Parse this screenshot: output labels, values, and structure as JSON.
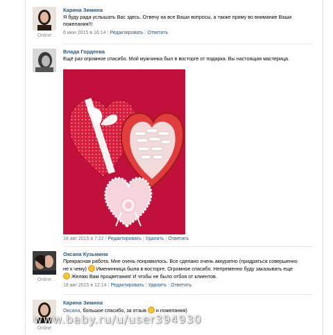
{
  "posts": [
    {
      "author": "Карина Зимина",
      "status": "Online",
      "text": "Я буду рада услышать Вас здесь. Отвечу на все Ваши вопросы, а также приму во внимание Ваши пожелания!!!",
      "date": "6 июн 2015 в 16:14",
      "actions": [
        "Редактировать",
        "Ответить"
      ]
    },
    {
      "author": "Влада Гордеева",
      "text": "Ещё раз огромное спасибо. Мой мужчинка был в восторге от подарка. Вы настоящая мастерица.",
      "date": "18 авг 2015 в 7:22",
      "actions": [
        "Редактировать",
        "Удалить",
        "Ответить"
      ]
    },
    {
      "author": "Оксана Кузьмина",
      "status": "Online",
      "text_line1": "Прекрасная работа. Мне очень понравилось. Все сделано очень аккуратно (придраться совершенно",
      "text_line2a": "не к чему)",
      "text_line2b": "Именинница была в восторге. Огромное спасибо. Непременно буду заказывать еще",
      "text_line3": "Желаю Вам процветания! И чтобы не было отбоя от клиентов.",
      "date": "18 авг 2015 в 12:14",
      "actions": [
        "Редактировать",
        "Удалить",
        "Ответить"
      ]
    },
    {
      "author": "Карина Зимина",
      "status": "Online",
      "reply_to": "Оксана",
      "text_a": ", большое спасибо, за отзыв",
      "text_b": "и пожелания)"
    }
  ],
  "watermark": "www.baby.ru/u/user394930",
  "colors": {
    "link": "#2b587a",
    "meta": "#777777",
    "photo_background": "#c4123c"
  }
}
